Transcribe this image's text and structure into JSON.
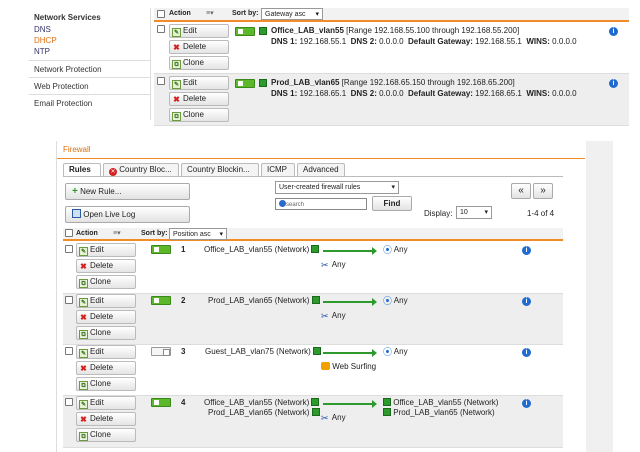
{
  "top_panel": {
    "nav": {
      "group_title": "Network Services",
      "sub_items": [
        {
          "label": "DNS",
          "active": false
        },
        {
          "label": "DHCP",
          "active": true
        },
        {
          "label": "NTP",
          "active": false
        }
      ],
      "items": [
        "Network Protection",
        "Web Protection",
        "Email Protection"
      ]
    },
    "header": {
      "action": "Action",
      "sort_label": "Sort by:",
      "sort_value": "Gateway asc"
    },
    "buttons": {
      "edit": "Edit",
      "delete": "Delete",
      "clone": "Clone"
    },
    "rows": [
      {
        "name": "Office_LAB_vlan55",
        "range": "[Range 192.168.55.100 through 192.168.55.200]",
        "dns1_label": "DNS 1:",
        "dns1": "192.168.55.1",
        "dns2_label": "DNS 2:",
        "dns2": "0.0.0.0",
        "gw_label": "Default Gateway:",
        "gw": "192.168.55.1",
        "wins_label": "WINS:",
        "wins": "0.0.0.0"
      },
      {
        "name": "Prod_LAB_vlan65",
        "range": "[Range 192.168.65.150 through 192.168.65.200]",
        "dns1_label": "DNS 1:",
        "dns1": "192.168.65.1",
        "dns2_label": "DNS 2:",
        "dns2": "0.0.0.0",
        "gw_label": "Default Gateway:",
        "gw": "192.168.65.1",
        "wins_label": "WINS:",
        "wins": "0.0.0.0"
      }
    ]
  },
  "firewall": {
    "title": "Firewall",
    "tabs": [
      "Rules",
      "Country Bloc...",
      "Country Blockin...",
      "ICMP",
      "Advanced"
    ],
    "new_rule": "New Rule...",
    "open_live_log": "Open Live Log",
    "filter_select": "User-created firewall rules",
    "search_placeholder": "search",
    "find": "Find",
    "display_label": "Display:",
    "display_value": "10",
    "paging": "1-4 of 4",
    "nav_prev": "«",
    "nav_next": "»",
    "header": {
      "action": "Action",
      "sort_label": "Sort by:",
      "sort_value": "Position asc"
    },
    "buttons": {
      "edit": "Edit",
      "delete": "Delete",
      "clone": "Clone"
    },
    "rows": [
      {
        "num": "1",
        "enabled": true,
        "sources": [
          "Office_LAB_vlan55 (Network)"
        ],
        "service": "Any",
        "service_icon": "service-icon",
        "destinations": [
          "Any"
        ]
      },
      {
        "num": "2",
        "enabled": true,
        "sources": [
          "Prod_LAB_vlan65 (Network)"
        ],
        "service": "Any",
        "service_icon": "service-icon",
        "destinations": [
          "Any"
        ]
      },
      {
        "num": "3",
        "enabled": false,
        "sources": [
          "Guest_LAB_vlan75 (Network)"
        ],
        "service": "Web Surfing",
        "service_icon": "web-icon",
        "destinations": [
          "Any"
        ]
      },
      {
        "num": "4",
        "enabled": true,
        "sources": [
          "Office_LAB_vlan55 (Network)",
          "Prod_LAB_vlan65 (Network)"
        ],
        "service": "Any",
        "service_icon": "service-icon",
        "destinations": [
          "Office_LAB_vlan55 (Network)",
          "Prod_LAB_vlan65 (Network)"
        ]
      }
    ]
  },
  "colors": {
    "accent": "#f28c28",
    "toggle_on": "#5cb82a",
    "info": "#1f6bd0"
  }
}
